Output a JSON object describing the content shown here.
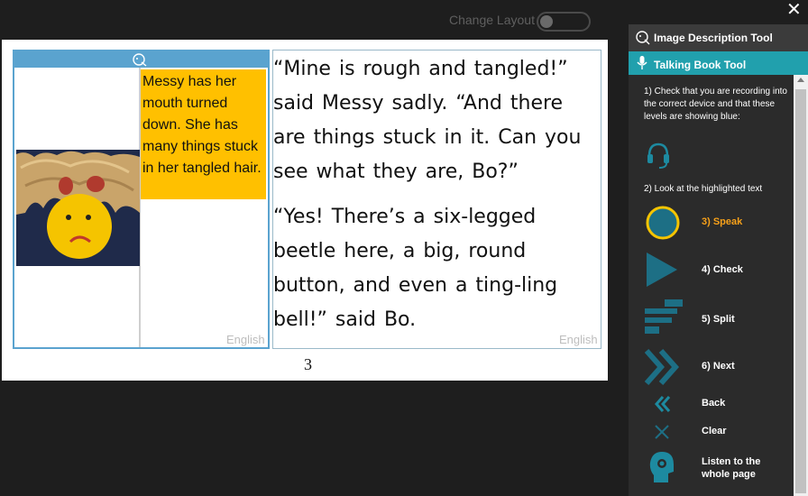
{
  "topbar": {
    "change_layout": "Change Layout",
    "close": "✕"
  },
  "page": {
    "image_description": "Messy has her mouth turned down. She has many things stuck in her tangled hair.",
    "language_image": "English",
    "paragraph1": "“Mine is rough and tangled!” said Messy sadly. “And there are things stuck in it. Can you see what they are, Bo?”",
    "paragraph2": "“Yes! There’s a six-legged beetle here, a big, round button, and even a ting-ling bell!” said Bo.",
    "language_text": "English",
    "page_number": "3"
  },
  "sidebar": {
    "image_description_tool": "Image Description Tool",
    "talking_book_tool": "Talking Book Tool",
    "instruction1": "1) Check that you are recording into the correct device and that these levels are showing blue:",
    "instruction2": "2) Look at the highlighted text",
    "steps": {
      "speak": "3) Speak",
      "check": "4) Check",
      "split": "5) Split",
      "next": "6) Next",
      "back": "Back",
      "clear": "Clear",
      "listen": "Listen to the whole page"
    },
    "colors": {
      "accent": "#21a0ad",
      "active": "#f7a11a",
      "icon": "#1d6f85"
    }
  }
}
